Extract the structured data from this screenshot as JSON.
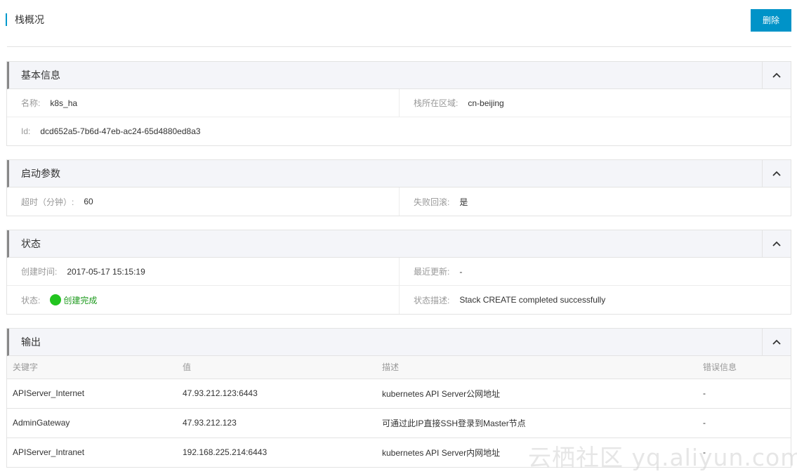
{
  "header": {
    "title": "栈概况",
    "delete_label": "删除"
  },
  "basic_info": {
    "title": "基本信息",
    "name_label": "名称:",
    "name_value": "k8s_ha",
    "region_label": "栈所在区域:",
    "region_value": "cn-beijing",
    "id_label": "Id:",
    "id_value": "dcd652a5-7b6d-47eb-ac24-65d4880ed8a3"
  },
  "launch_params": {
    "title": "启动参数",
    "timeout_label": "超时（分钟）:",
    "timeout_value": "60",
    "rollback_label": "失败回滚:",
    "rollback_value": "是"
  },
  "status": {
    "title": "状态",
    "created_label": "创建时间:",
    "created_value": "2017-05-17 15:15:19",
    "updated_label": "最近更新:",
    "updated_value": "-",
    "state_label": "状态:",
    "state_value": "创建完成",
    "state_color": "#22c41f",
    "desc_label": "状态描述:",
    "desc_value": "Stack CREATE completed successfully"
  },
  "outputs": {
    "title": "输出",
    "columns": [
      "关键字",
      "值",
      "描述",
      "错误信息"
    ],
    "rows": [
      [
        "APIServer_Internet",
        "47.93.212.123:6443",
        "kubernetes API Server公网地址",
        "-"
      ],
      [
        "AdminGateway",
        "47.93.212.123",
        "可通过此IP直接SSH登录到Master节点",
        "-"
      ],
      [
        "APIServer_Intranet",
        "192.168.225.214:6443",
        "kubernetes API Server内网地址",
        "-"
      ]
    ]
  },
  "watermark": "云栖社区 yq.aliyun.com",
  "colors": {
    "accent": "#0093c8",
    "success": "#22c41f"
  }
}
